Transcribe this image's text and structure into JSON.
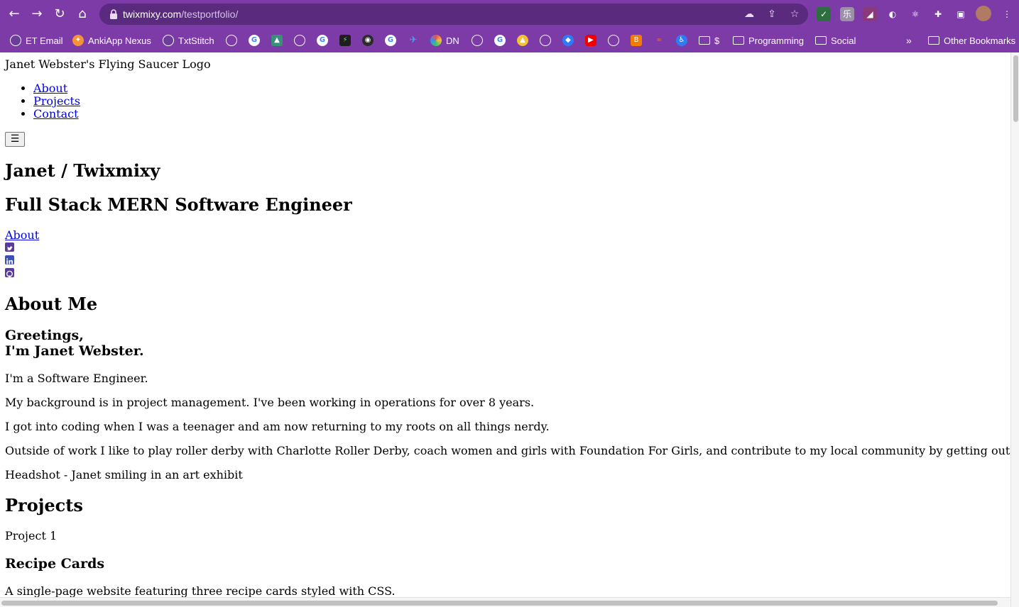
{
  "browser": {
    "url_host": "twixmixy.com",
    "url_path": "/testportfolio/",
    "bookmarks": [
      {
        "label": "ET Email",
        "color": "#6a3e9a"
      },
      {
        "label": "AnkiApp Nexus",
        "color": "#f2933a"
      },
      {
        "label": "TxtStitch",
        "color": "#6a3e9a"
      }
    ],
    "bookmark_dn": "DN",
    "bookmark_dollar": "$",
    "folders": [
      "Programming",
      "Social"
    ],
    "overflow": "»",
    "other_bookmarks": "Other Bookmarks"
  },
  "page": {
    "logo_alt": "Janet Webster's Flying Saucer Logo",
    "nav": [
      "About",
      "Projects",
      "Contact"
    ],
    "menu_button": "☰",
    "hero_title": "Janet / Twixmixy",
    "hero_subtitle": "Full Stack MERN Software Engineer",
    "hero_link": "About",
    "social": [
      "twitter-icon",
      "linkedin-icon",
      "github-icon"
    ],
    "about": {
      "heading": "About Me",
      "greeting_line1": "Greetings,",
      "greeting_line2": "I'm Janet Webster.",
      "paragraphs": [
        "I'm a Software Engineer.",
        "My background is in project management. I've been working in operations for over 8 years.",
        "I got into coding when I was a teenager and am now returning to my roots on all things nerdy.",
        "Outside of work I like to play roller derby with Charlotte Roller Derby, coach women and girls with Foundation For Girls, and contribute to my local community by getting out the vote."
      ],
      "headshot_alt": "Headshot - Janet smiling in an art exhibit"
    },
    "projects": {
      "heading": "Projects",
      "items": [
        {
          "image_alt": "Project 1",
          "title": "Recipe Cards",
          "description": "A single-page website featuring three recipe cards styled with CSS."
        }
      ]
    }
  }
}
